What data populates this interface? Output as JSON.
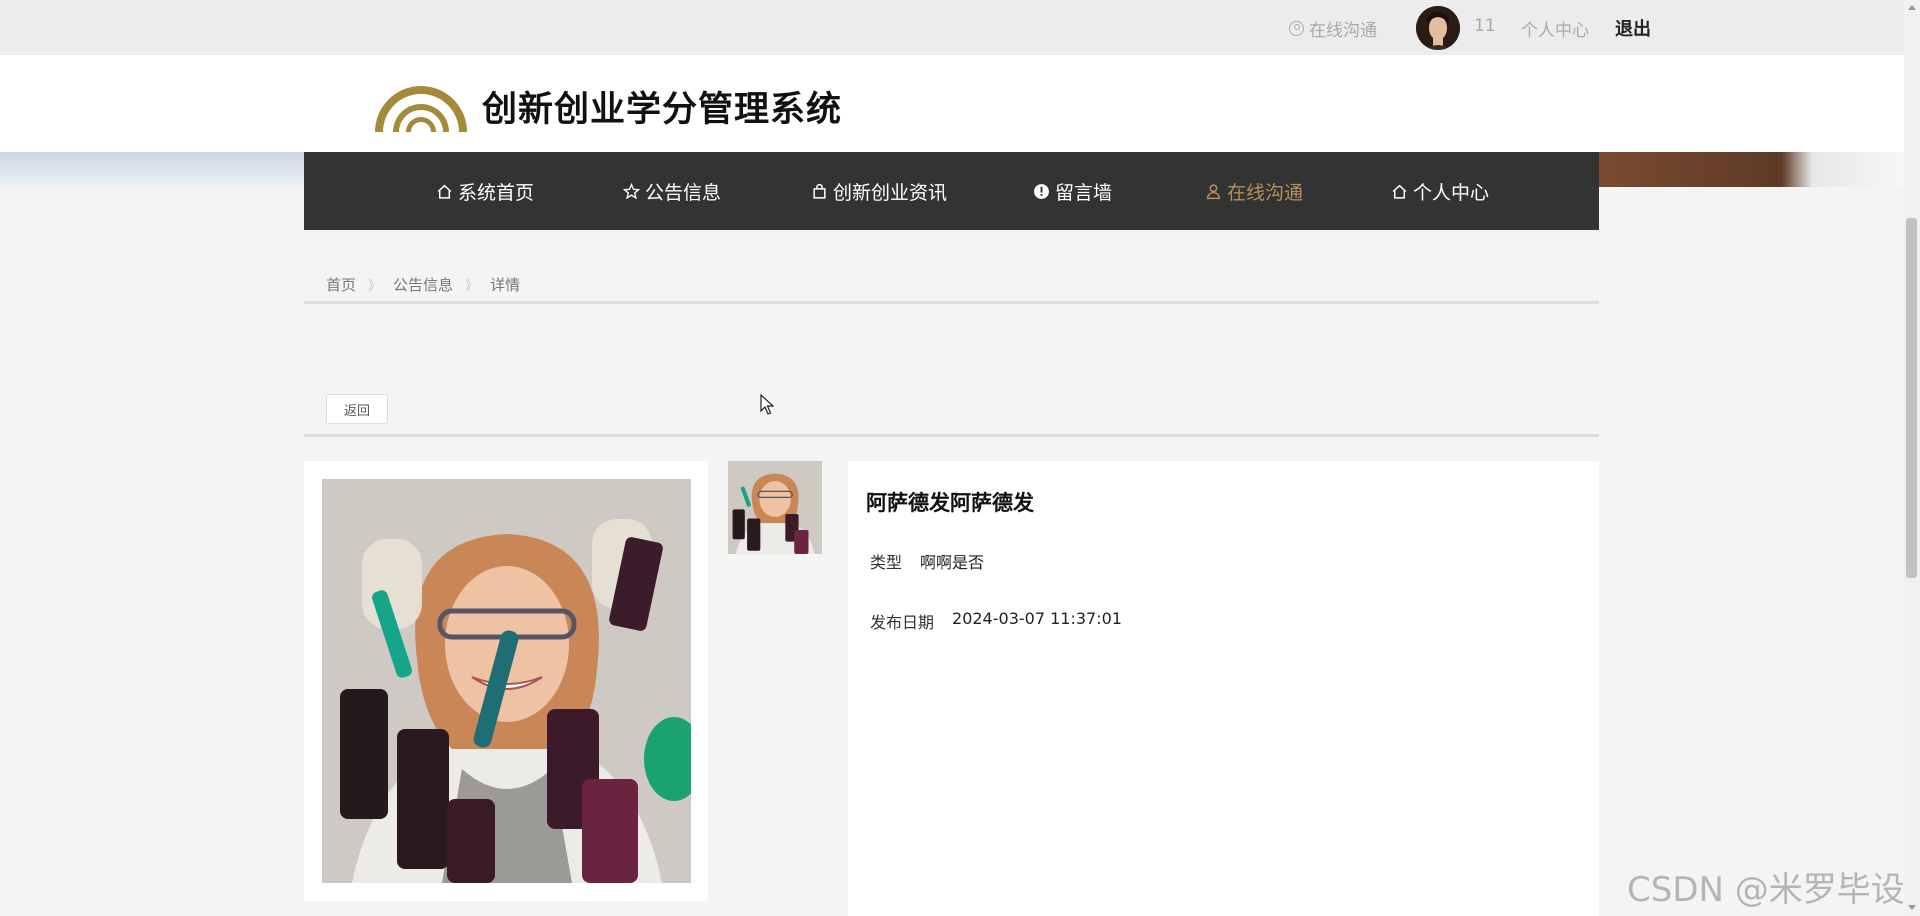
{
  "topbar": {
    "chat_label": "在线沟通",
    "username": "11",
    "center_label": "个人中心",
    "logout_label": "退出"
  },
  "header": {
    "site_title": "创新创业学分管理系统"
  },
  "nav": {
    "items": [
      {
        "label": "系统首页",
        "icon": "home-icon"
      },
      {
        "label": "公告信息",
        "icon": "star-icon"
      },
      {
        "label": "创新创业资讯",
        "icon": "bag-icon"
      },
      {
        "label": "留言墙",
        "icon": "alert-icon"
      },
      {
        "label": "在线沟通",
        "icon": "user-icon",
        "active": true
      },
      {
        "label": "个人中心",
        "icon": "home-icon"
      }
    ],
    "active_color": "#b3915a"
  },
  "breadcrumb": {
    "items": [
      "首页",
      "公告信息",
      "详情"
    ],
    "separator": "》"
  },
  "back_button": "返回",
  "detail": {
    "title": "阿萨德发阿萨德发",
    "fields": [
      {
        "label": "类型",
        "value": "啊啊是否"
      },
      {
        "label": "发布日期",
        "value": "2024-03-07 11:37:01"
      }
    ]
  },
  "watermark": "CSDN @米罗毕设",
  "colors": {
    "nav_bg": "#333333",
    "accent": "#b3915a"
  }
}
